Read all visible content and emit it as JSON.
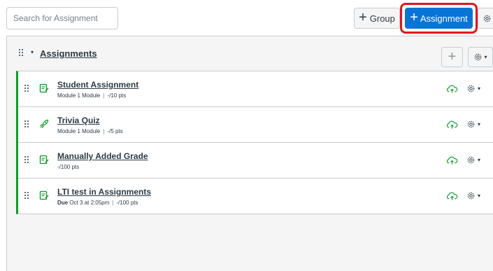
{
  "toolbar": {
    "search_placeholder": "Search for Assignment",
    "group_button": "Group",
    "assignment_button": "Assignment",
    "plus_glyph": "+"
  },
  "group": {
    "title": "Assignments"
  },
  "assignments": [
    {
      "title": "Student Assignment",
      "module": "Module 1 Module",
      "points": "-/10 pts",
      "type": "assignment-icon"
    },
    {
      "title": "Trivia Quiz",
      "module": "Module 1 Module",
      "points": "-/5 pts",
      "type": "quiz-icon"
    },
    {
      "title": "Manually Added Grade",
      "points": "-/100 pts",
      "type": "assignment-icon"
    },
    {
      "title": "LTI test in Assignments",
      "due_label": "Due",
      "due_date": "Oct 3 at 2:05pm",
      "points": "-/100 pts",
      "type": "assignment-icon"
    }
  ],
  "colors": {
    "primary": "#0874d8",
    "published_bar": "#0b9c2a",
    "highlight": "#e0151e",
    "icon_green": "#0b9c2a"
  }
}
